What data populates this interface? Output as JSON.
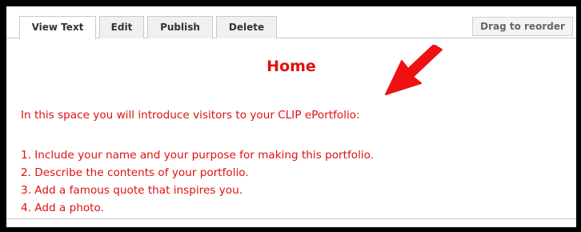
{
  "tabs": [
    {
      "label": "View Text",
      "active": true
    },
    {
      "label": "Edit",
      "active": false
    },
    {
      "label": "Publish",
      "active": false
    },
    {
      "label": "Delete",
      "active": false
    }
  ],
  "reorder_label": "Drag to reorder",
  "page": {
    "title": "Home",
    "intro": "In this space you will introduce visitors to your CLIP ePortfolio:",
    "steps": [
      "1. Include your name and your purpose for making this portfolio.",
      "2. Describe the contents of your portfolio.",
      "3. Add a famous quote that inspires you.",
      "4. Add a photo."
    ]
  },
  "annotation": {
    "icon": "arrow-icon",
    "color": "#ee1111"
  },
  "colors": {
    "text_accent": "#e01010",
    "frame": "#000000",
    "tab_border": "#c8c8c8"
  }
}
